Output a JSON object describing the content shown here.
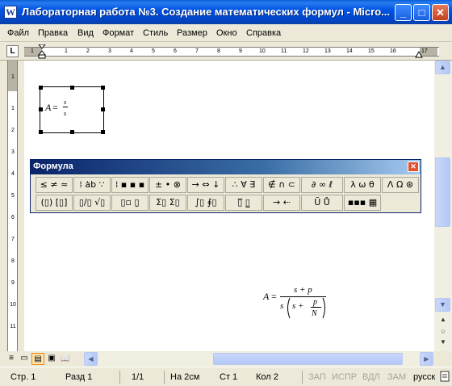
{
  "window": {
    "icon": "W",
    "title": "Лабораторная работа №3. Создание математических формул - Micro...",
    "minimize": "_",
    "maximize": "□",
    "close": "✕"
  },
  "menu": [
    "Файл",
    "Правка",
    "Вид",
    "Формат",
    "Стиль",
    "Размер",
    "Окно",
    "Справка"
  ],
  "ruler": {
    "corner": "L",
    "numbers": [
      "1",
      "1",
      "2",
      "3",
      "4",
      "5",
      "6",
      "7",
      "8",
      "9",
      "10",
      "11",
      "12",
      "13",
      "14",
      "15",
      "16",
      "17"
    ],
    "vnumbers": [
      "1",
      "1",
      "2",
      "3",
      "4",
      "5",
      "6",
      "7",
      "8",
      "9",
      "10",
      "11"
    ]
  },
  "small_formula": {
    "lhs": "A",
    "eq": "=",
    "num": "s",
    "den": "s"
  },
  "palette": {
    "title": "Формула",
    "close": "✕",
    "row1": [
      "≤ ≠ ≈",
      "⁞ ȧb ∵",
      "⁞ ▪ ▪ ▪",
      "± • ⊗",
      "→ ⇔ ↓",
      "∴ ∀ ∃",
      "∉ ∩ ⊂",
      "∂ ∞ ℓ",
      "λ ω θ",
      "Λ Ω ⊛"
    ],
    "row2": [
      "(▯) [▯]",
      "▯/▯ √▯",
      "▯▫ ▯̣",
      "Σ▯ Σ▯",
      "∫▯ ∮▯",
      "▯̅ ▯̲",
      "→ ⇠",
      "Ũ Ů",
      "▪▪▪ ▦"
    ]
  },
  "big_formula": {
    "lhs": "A",
    "eq": "=",
    "num": "s + p",
    "den_s": "s",
    "den_inner_s": "s +",
    "frac_num": "p",
    "frac_den": "N"
  },
  "vscroll": {
    "up": "▲",
    "down": "▼",
    "prev": "▲",
    "select": "○",
    "next": "▼"
  },
  "views": [
    "≡",
    "▭",
    "▤",
    "▣",
    "📖"
  ],
  "hscroll": {
    "left": "◀",
    "right": "▶"
  },
  "status": {
    "page": "Стр. 1",
    "section": "Разд 1",
    "pages": "1/1",
    "at": "На 2см",
    "line": "Ст 1",
    "col": "Кол 2",
    "rec": "ЗАП",
    "trk": "ИСПР",
    "ext": "ВДЛ",
    "ovr": "ЗАМ",
    "lang": "русск"
  }
}
